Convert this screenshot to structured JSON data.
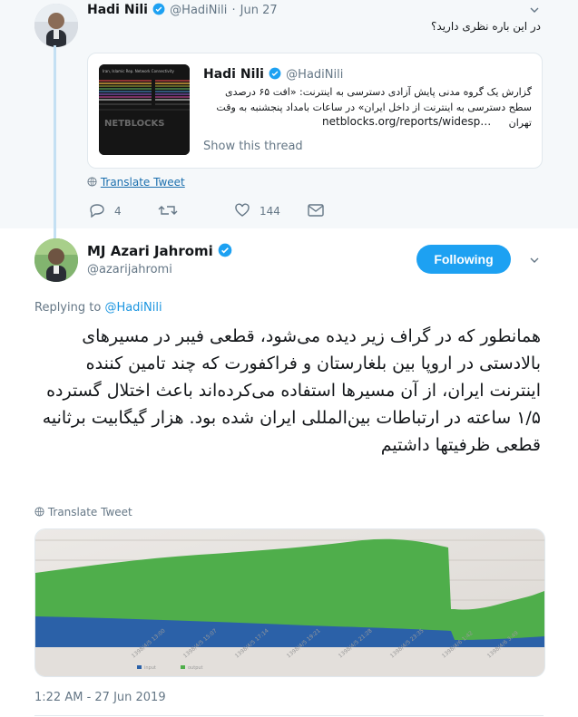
{
  "parent_tweet": {
    "author_name": "Hadi Nili",
    "author_handle": "@HadiNili",
    "dot": "·",
    "date": "Jun 27",
    "text": "در این باره نظری دارید؟",
    "quoted": {
      "author_name": "Hadi Nili",
      "author_handle": "@HadiNili",
      "text": "گزارش یک گروه مدنی پایش آزادی دسترسی به اینترنت: «افت ۶۵ درصدی سطح دسترسی به اینترنت از داخل ایران» در ساعات بامداد پنجشنبه به وقت تهران",
      "link": "netblocks.org/reports/widesp…",
      "show_thread": "Show this thread",
      "image_caption": "NETBLOCKS"
    },
    "translate": "Translate Tweet",
    "replies": "4",
    "retweets": "",
    "likes": "144"
  },
  "main_tweet": {
    "author_name": "MJ Azari Jahromi",
    "author_handle": "@azarijahromi",
    "follow_label": "Following",
    "replying_prefix": "Replying to ",
    "replying_to": "@HadiNili",
    "text": "همانطور که در گراف زیر دیده می‌شود، قطعی فیبر در مسیرهای بالادستی در اروپا بین بلغارستان و فراکفورت که چند تامین کننده اینترنت ایران، از آن مسیرها استفاده می‌کرده‌اند باعث اختلال گسترده ۱/۵ ساعته در ارتباطات بین‌المللی ایران شده بود. هزار گیگابیت برثانیه قطعی ظرفیتها داشتیم",
    "translate": "Translate Tweet",
    "timestamp": "1:22 AM - 27 Jun 2019"
  },
  "colors": {
    "accent": "#1da1f2",
    "chart_green": "#4fae4b",
    "chart_blue": "#2b61a8",
    "bg_parent": "#f5f8fa"
  },
  "icons": [
    "verified-badge-icon",
    "chevron-down-icon",
    "globe-icon",
    "reply-icon",
    "retweet-icon",
    "like-icon",
    "message-icon"
  ]
}
